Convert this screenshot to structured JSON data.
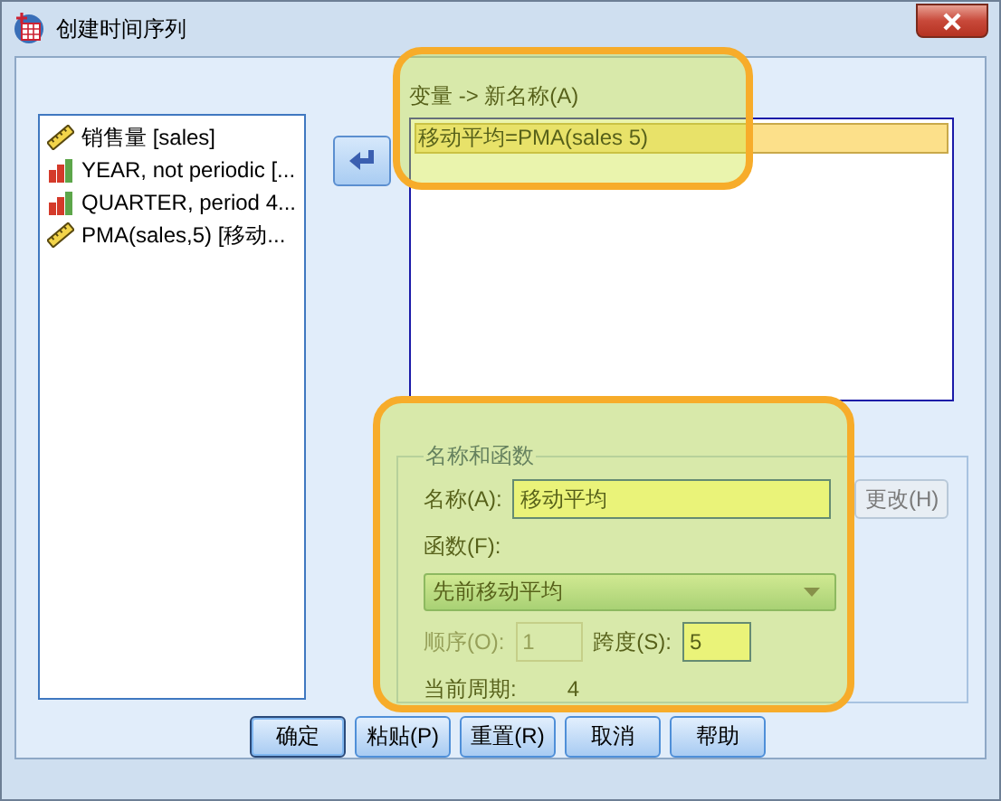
{
  "window": {
    "title": "创建时间序列"
  },
  "variables": [
    {
      "name": "销售量 [sales]",
      "kind": "scale"
    },
    {
      "name": "YEAR, not periodic [...",
      "kind": "ordinal"
    },
    {
      "name": "QUARTER, period 4...",
      "kind": "ordinal"
    },
    {
      "name": "PMA(sales,5) [移动...",
      "kind": "scale"
    }
  ],
  "new_variables": {
    "label": "变量 -> 新名称(A)",
    "items": [
      {
        "text": "移动平均=PMA(sales 5)",
        "selected": true
      }
    ]
  },
  "name_and_function": {
    "legend": "名称和函数",
    "name_label": "名称(A):",
    "name_value": "移动平均",
    "change_button": {
      "label": "更改(H)",
      "disabled": true
    },
    "function_label": "函数(F):",
    "function_value": "先前移动平均",
    "order": {
      "label": "顺序(O):",
      "value": "1",
      "disabled": true
    },
    "span": {
      "label": "跨度(S):",
      "value": "5",
      "disabled": false
    },
    "periodicity_label": "当前周期:",
    "periodicity_value": "4"
  },
  "buttons": [
    {
      "label": "确定",
      "default": true
    },
    {
      "label": "粘贴(P)",
      "default": false
    },
    {
      "label": "重置(R)",
      "default": false
    },
    {
      "label": "取消",
      "default": false
    },
    {
      "label": "帮助",
      "default": false
    }
  ]
}
